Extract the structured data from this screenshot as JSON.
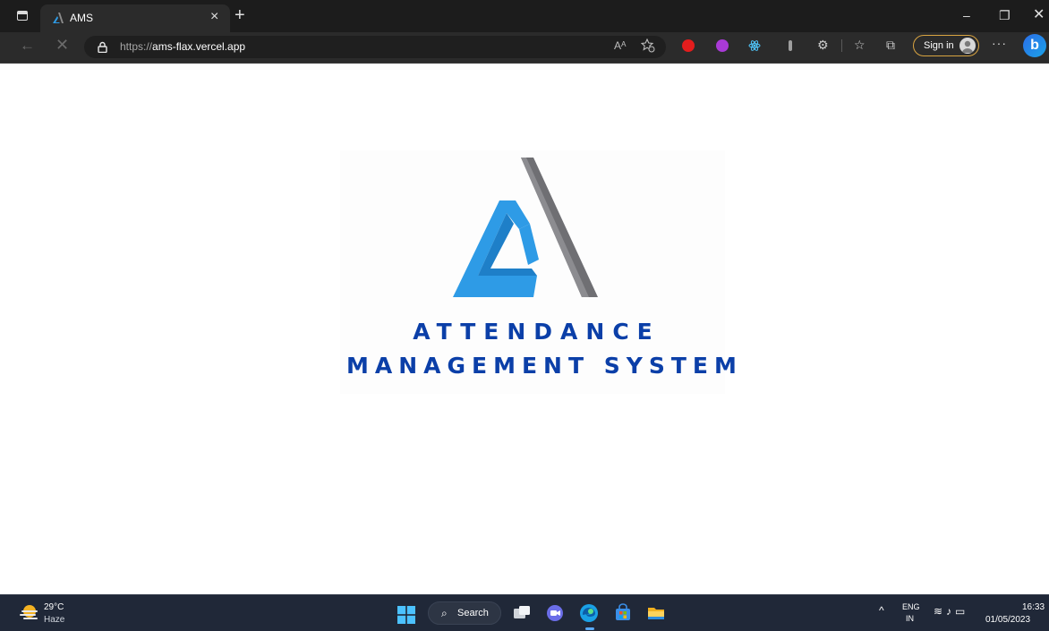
{
  "browser": {
    "tab_title": "AMS",
    "tab_close": "×",
    "new_tab": "+",
    "window_minimize": "–",
    "window_restore": "❐",
    "window_close": "✕",
    "nav_back": "←",
    "nav_stop": "✕",
    "url_protocol": "https://",
    "url_host": "ams-flax.vercel.app",
    "read_aloud": "Aᴬ",
    "sign_in_label": "Sign in",
    "more_label": "···",
    "copilot_label": "b"
  },
  "page": {
    "logo_line_1": "ATTENDANCE",
    "logo_line_2": "MANAGEMENT SYSTEM",
    "colors": {
      "logo_blue": "#2e9be6",
      "logo_gray": "#6f6f73",
      "text_navy": "#0b3fa8"
    }
  },
  "taskbar": {
    "weather_temp": "29°C",
    "weather_desc": "Haze",
    "search_label": "Search",
    "lang_1": "ENG",
    "lang_2": "IN",
    "clock_time": "16:33",
    "clock_date": "01/05/2023",
    "apps": [
      "task-view-icon",
      "chat-icon",
      "edge-icon",
      "store-icon",
      "file-explorer-icon"
    ]
  }
}
